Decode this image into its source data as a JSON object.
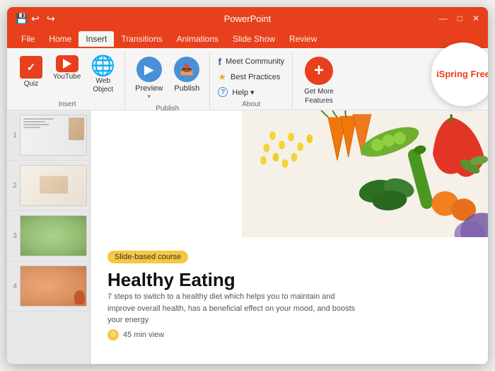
{
  "window": {
    "title": "PowerPoint",
    "controls": {
      "minimize": "—",
      "maximize": "□",
      "close": "✕"
    }
  },
  "ribbon": {
    "tabs": [
      "File",
      "Home",
      "Insert",
      "Transitions",
      "Animations",
      "Slide Show",
      "Review"
    ],
    "active_tab": "Insert",
    "groups": {
      "insert": {
        "label": "Insert",
        "items": [
          {
            "id": "quiz",
            "label": "Quiz",
            "icon": "✓"
          },
          {
            "id": "youtube",
            "label": "YouTube"
          },
          {
            "id": "webobject",
            "label": "Web\nObject",
            "icon": "🌐"
          }
        ]
      },
      "publish": {
        "label": "Publish",
        "items": [
          {
            "id": "preview",
            "label": "Preview"
          },
          {
            "id": "publish",
            "label": "Publish"
          }
        ]
      },
      "about": {
        "label": "About",
        "items": [
          {
            "id": "meet",
            "label": "Meet Community",
            "icon": "f"
          },
          {
            "id": "best",
            "label": "Best Practices",
            "icon": "★"
          },
          {
            "id": "help",
            "label": "Help ▾",
            "icon": "?"
          }
        ]
      },
      "getmore": {
        "label": "Get More\nFeatures",
        "icon": "+"
      }
    },
    "ispring": {
      "label": "iSpring Free"
    }
  },
  "slides": [
    {
      "number": "1",
      "label": "Slide 1"
    },
    {
      "number": "2",
      "label": "Slide 2"
    },
    {
      "number": "3",
      "label": "Slide 3"
    },
    {
      "number": "4",
      "label": "Slide 4"
    }
  ],
  "slide_content": {
    "badge": "Slide-based course",
    "title": "Healthy Eating",
    "description": "7 steps to switch to a healthy diet which helps you to maintain and improve overall health, has a beneficial effect on your mood, and boosts your energy",
    "meta": "45 min view"
  }
}
